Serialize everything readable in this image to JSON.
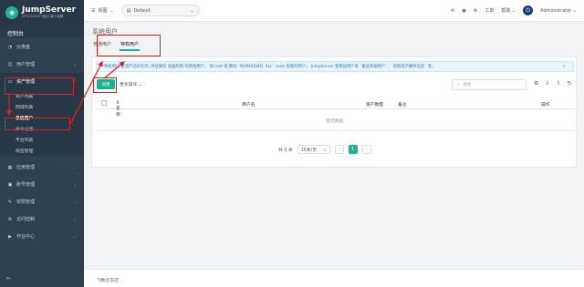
{
  "logo": {
    "name": "JumpServer",
    "subtitle": "FIT2CLOUD飞致云 旗下品牌"
  },
  "sidebar": {
    "console": "控制台",
    "items": [
      {
        "icon": "dashboard-icon",
        "label": "仪表盘"
      },
      {
        "icon": "users-icon",
        "label": "用户管理"
      },
      {
        "icon": "inbox-icon",
        "label": "资产管理"
      },
      {
        "icon": "apps-icon",
        "label": "应用管理"
      },
      {
        "icon": "account-icon",
        "label": "账号管理"
      },
      {
        "icon": "permission-icon",
        "label": "权限管理"
      },
      {
        "icon": "access-control-icon",
        "label": "访问控制"
      },
      {
        "icon": "job-center-icon",
        "label": "作业中心"
      }
    ],
    "subitems": [
      "资产列表",
      "网域列表",
      "系统用户",
      "命令过滤",
      "平台列表",
      "标签管理"
    ]
  },
  "topbar": {
    "view": "视图",
    "org": "Default",
    "tickets": "工单",
    "help": "帮助",
    "user": "Administrator"
  },
  "page": {
    "title": "系统用户",
    "tabs": [
      "普通用户",
      "特权用户"
    ]
  },
  "alert": {
    "text": "特权用户 是资产已存在的, 并且拥有 高级权限 的系统用户， 如 root 或 拥有 `NOPASSWD: ALL` sudo 权限的用户。 JumpServer 使用该用户来 `推送系统用户`、`获取资产硬件信息` 等。"
  },
  "toolbar": {
    "create": "创建",
    "more": "更多操作",
    "search_placeholder": "搜索"
  },
  "table": {
    "columns": [
      "名称",
      "用户名",
      "资产数量",
      "备注",
      "操作"
    ],
    "empty": "暂无数据"
  },
  "pagination": {
    "total": "共 0 条",
    "page_size": "15条/页",
    "current": "1"
  },
  "footer": {
    "text": "飞致云东区"
  },
  "colors": {
    "accent": "#1ab394",
    "sidebar": "#2f4050",
    "annotation": "#e02020"
  }
}
